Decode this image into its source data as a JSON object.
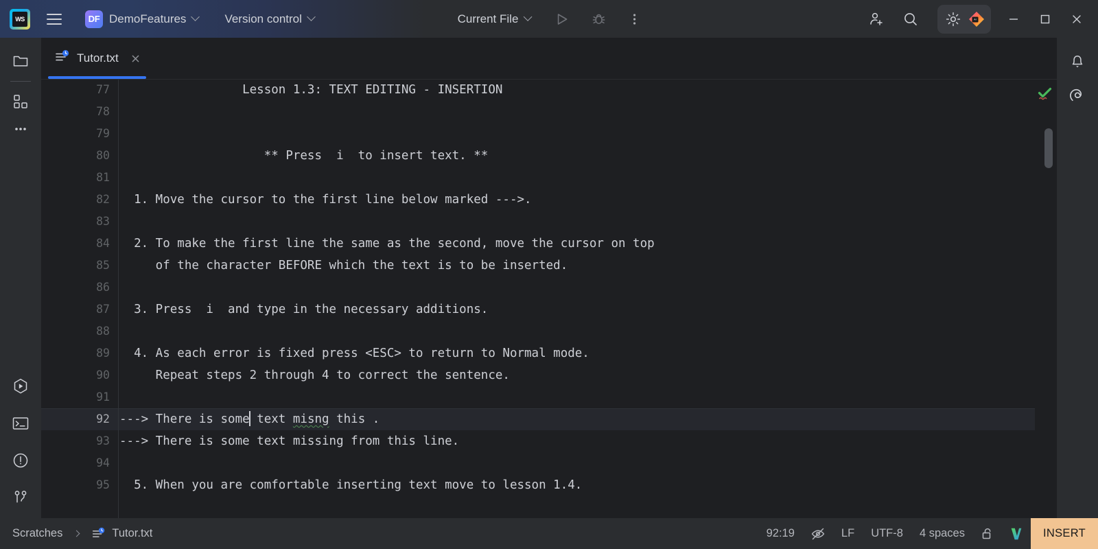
{
  "titlebar": {
    "app_logo": "webstorm-logo",
    "main_menu_icon": "hamburger-menu-icon",
    "project_badge": "DF",
    "project_name": "DemoFeatures",
    "vcs_label": "Version control",
    "run_config_label": "Current File",
    "run_icon": "run-icon",
    "debug_icon": "debug-icon",
    "more_icon": "more-vertical-icon",
    "add_user_icon": "add-user-icon",
    "search_icon": "search-icon",
    "settings_icon": "gear-icon",
    "ai_icon": "ai-assistant-icon",
    "minimize_label": "minimize",
    "maximize_label": "maximize",
    "close_label": "close",
    "accent_blue": "#3574F0"
  },
  "left_sidebar": {
    "items": [
      {
        "name": "project-tool-window",
        "icon": "folder-icon"
      },
      {
        "name": "structure-tool-window",
        "icon": "widgets-icon"
      },
      {
        "name": "more-tool-windows",
        "icon": "ellipsis-icon"
      }
    ],
    "bottom_items": [
      {
        "name": "run-tool-window",
        "icon": "run-hexagon-icon"
      },
      {
        "name": "terminal-tool-window",
        "icon": "terminal-icon"
      },
      {
        "name": "problems-tool-window",
        "icon": "warning-circle-icon"
      },
      {
        "name": "version-control-tool-window",
        "icon": "git-branch-icon"
      }
    ]
  },
  "right_sidebar": {
    "items": [
      {
        "name": "notifications",
        "icon": "bell-icon"
      },
      {
        "name": "ai-chat",
        "icon": "spiral-icon"
      }
    ]
  },
  "tabs": [
    {
      "label": "Tutor.txt",
      "icon": "text-file-modified-icon",
      "active": true,
      "close_icon": "close-icon"
    }
  ],
  "editor": {
    "first_line": 77,
    "inspection_status": "ok-with-typos",
    "lines": [
      {
        "n": 77,
        "text": "                 Lesson 1.3: TEXT EDITING - INSERTION"
      },
      {
        "n": 78,
        "text": ""
      },
      {
        "n": 79,
        "text": ""
      },
      {
        "n": 80,
        "text": "                    ** Press  i  to insert text. **"
      },
      {
        "n": 81,
        "text": ""
      },
      {
        "n": 82,
        "text": "  1. Move the cursor to the first line below marked --->."
      },
      {
        "n": 83,
        "text": ""
      },
      {
        "n": 84,
        "text": "  2. To make the first line the same as the second, move the cursor on top"
      },
      {
        "n": 85,
        "text": "     of the character BEFORE which the text is to be inserted."
      },
      {
        "n": 86,
        "text": ""
      },
      {
        "n": 87,
        "text": "  3. Press  i  and type in the necessary additions."
      },
      {
        "n": 88,
        "text": ""
      },
      {
        "n": 89,
        "text": "  4. As each error is fixed press <ESC> to return to Normal mode."
      },
      {
        "n": 90,
        "text": "     Repeat steps 2 through 4 to correct the sentence."
      },
      {
        "n": 91,
        "text": ""
      },
      {
        "n": 92,
        "text": "---> There is some text misng this .",
        "active": true,
        "segments": [
          {
            "t": "---> There is some"
          },
          {
            "t": "",
            "caret": true
          },
          {
            "t": " text "
          },
          {
            "t": "misng",
            "typo": true
          },
          {
            "t": " this ."
          }
        ]
      },
      {
        "n": 93,
        "text": "---> There is some text missing from this line."
      },
      {
        "n": 94,
        "text": ""
      },
      {
        "n": 95,
        "text": "  5. When you are comfortable inserting text move to lesson 1.4."
      }
    ]
  },
  "statusbar": {
    "breadcrumb": [
      {
        "label": "Scratches",
        "icon": ""
      },
      {
        "label": "Tutor.txt",
        "icon": "text-file-modified-icon"
      }
    ],
    "caret_position": "92:19",
    "inspections_icon": "eye-crossed-icon",
    "line_separator": "LF",
    "encoding": "UTF-8",
    "indent": "4 spaces",
    "lock_icon": "unlocked-padlock-icon",
    "vim_icon": "vim-logo-icon",
    "vim_mode": "INSERT",
    "vim_mode_bg": "#F2C492",
    "vim_mode_fg": "#1B1B1B"
  }
}
